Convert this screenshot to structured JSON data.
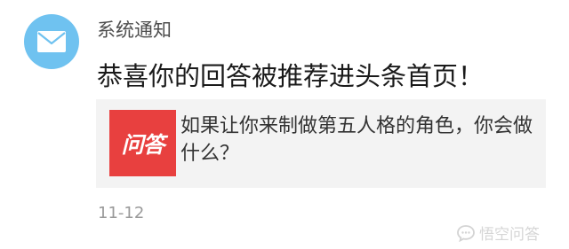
{
  "notification": {
    "sender": "系统通知",
    "headline": "恭喜你的回答被推荐进头条首页！",
    "card": {
      "logo_text": "问答",
      "question": "如果让你来制做第五人格的角色，你会做什么？"
    },
    "date": "11-12"
  },
  "watermark": {
    "text": "悟空问答"
  },
  "icons": {
    "avatar": "mail-envelope-icon",
    "watermark": "chat-bubble-icon"
  },
  "colors": {
    "avatar_bg": "#6fc2f0",
    "logo_bg": "#e8403f",
    "card_bg": "#f3f3f3"
  }
}
